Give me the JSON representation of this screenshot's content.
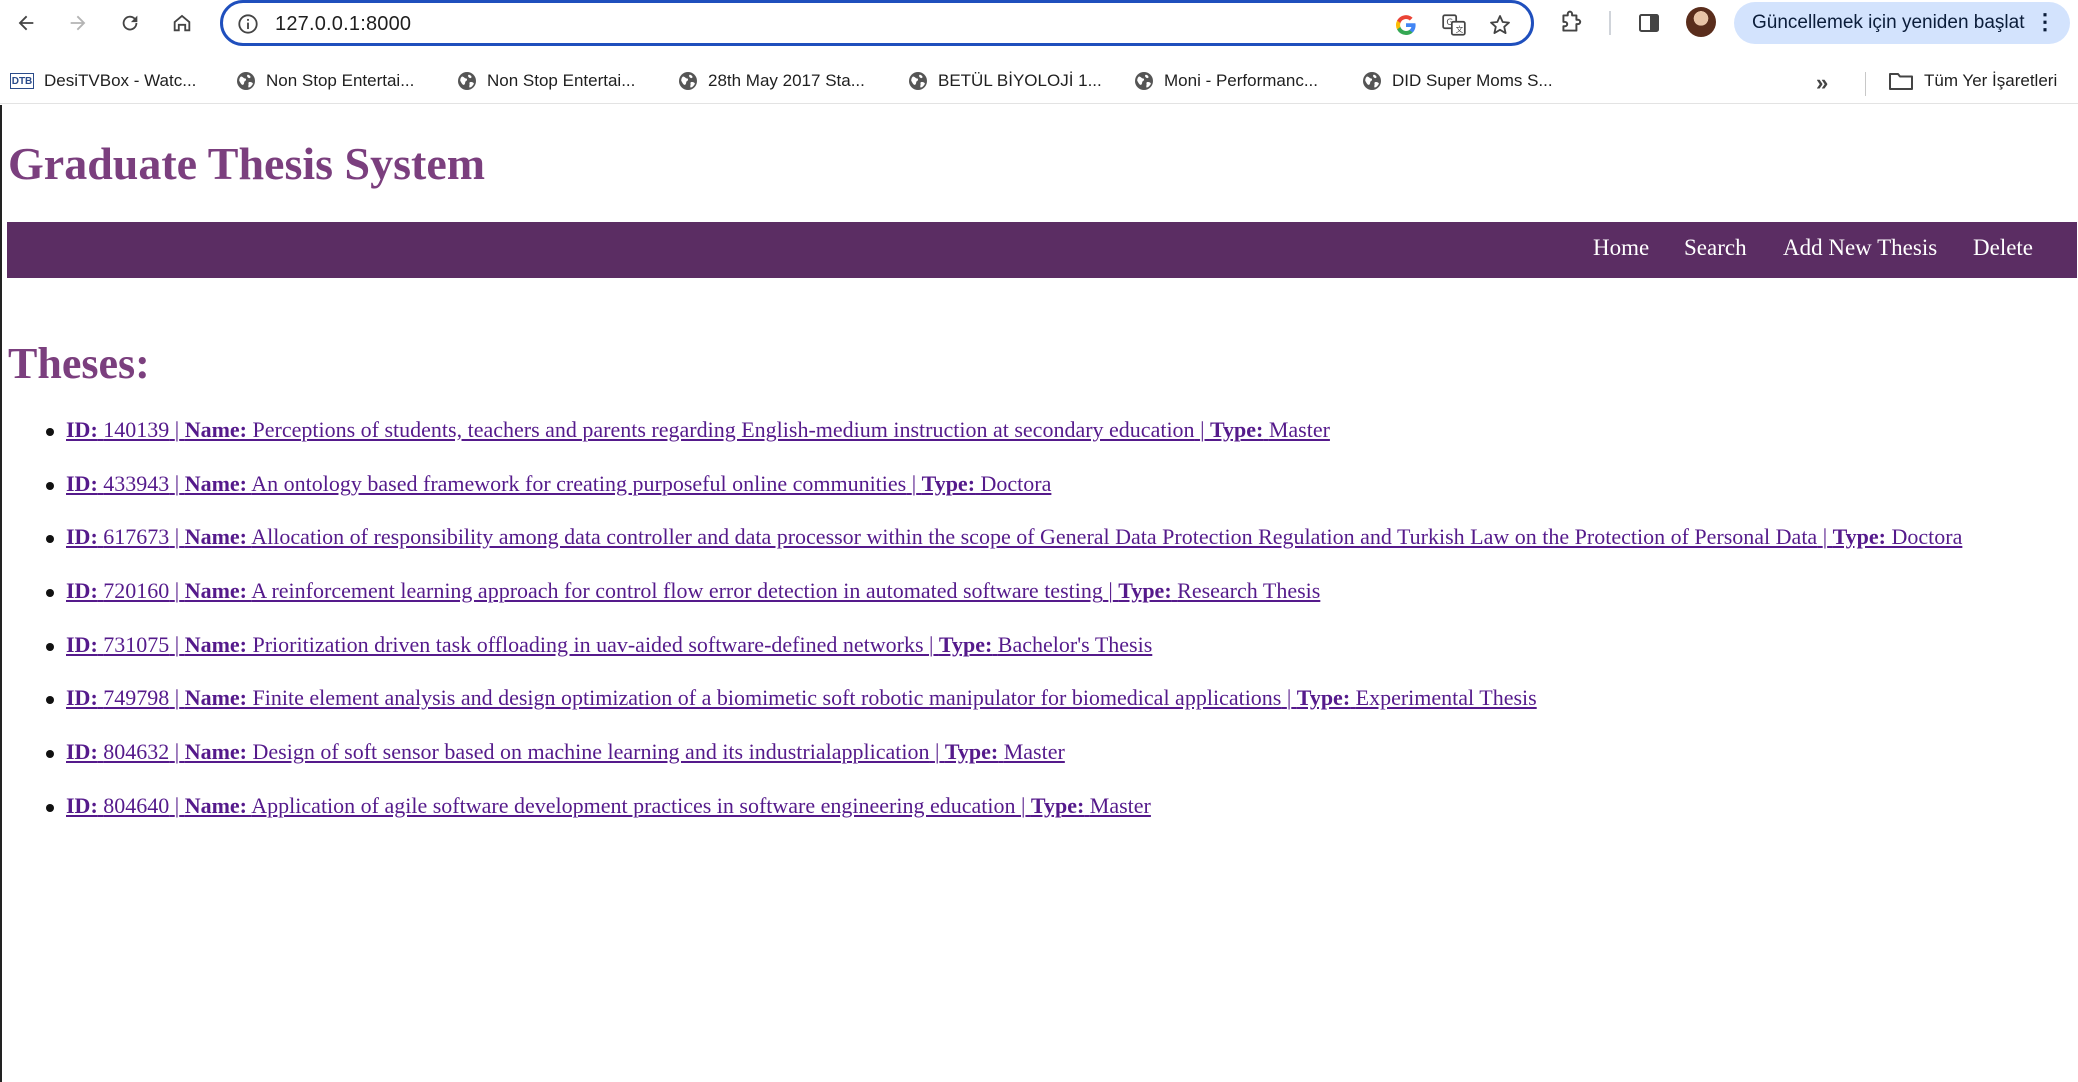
{
  "browser": {
    "url": "127.0.0.1:8000",
    "update_label": "Güncellemek için yeniden başlat",
    "icons": {
      "back": "arrow-left-icon",
      "forward": "arrow-right-icon",
      "reload": "reload-icon",
      "home": "home-icon",
      "site_info": "info-icon",
      "google": "google-icon",
      "translate": "translate-icon",
      "bookmark": "star-icon",
      "extensions": "puzzle-icon",
      "side_panel": "side-panel-icon",
      "menu": "kebab-menu-icon"
    }
  },
  "bookmarks": {
    "items": [
      {
        "label": "DesiTVBox - Watc...",
        "icon": "dtb-icon"
      },
      {
        "label": "Non Stop Entertai...",
        "icon": "globe-icon"
      },
      {
        "label": "Non Stop Entertai...",
        "icon": "globe-icon"
      },
      {
        "label": "28th May 2017 Sta...",
        "icon": "globe-icon"
      },
      {
        "label": "BETÜL BİYOLOJİ 1...",
        "icon": "globe-icon"
      },
      {
        "label": "Moni - Performanc...",
        "icon": "globe-icon"
      },
      {
        "label": "DID Super Moms S...",
        "icon": "globe-icon"
      }
    ],
    "more": "»",
    "all_bookmarks": "Tüm Yer İşaretleri"
  },
  "site": {
    "title": "Graduate Thesis System",
    "nav": [
      "Home",
      "Search",
      "Add New Thesis",
      "Delete"
    ],
    "section_title": "Theses:",
    "labels": {
      "id": "ID:",
      "name": "Name:",
      "type": "Type:",
      "sep": "|"
    },
    "theses": [
      {
        "id": "140139",
        "name": "Perceptions of students, teachers and parents regarding English-medium instruction at secondary education",
        "type": "Master"
      },
      {
        "id": "433943",
        "name": "An ontology based framework for creating purposeful online communities",
        "type": "Doctora"
      },
      {
        "id": "617673",
        "name": "Allocation of responsibility among data controller and data processor within the scope of General Data Protection Regulation and Turkish Law on the Protection of Personal Data",
        "type": "Doctora"
      },
      {
        "id": "720160",
        "name": "A reinforcement learning approach for control flow error detection in automated software testing",
        "type": "Research Thesis"
      },
      {
        "id": "731075",
        "name": "Prioritization driven task offloading in uav-aided software-defined networks",
        "type": "Bachelor's Thesis"
      },
      {
        "id": "749798",
        "name": "Finite element analysis and design optimization of a biomimetic soft robotic manipulator for biomedical applications",
        "type": "Experimental Thesis"
      },
      {
        "id": "804632",
        "name": "Design of soft sensor based on machine learning and its industrialapplication",
        "type": "Master"
      },
      {
        "id": "804640",
        "name": "Application of agile software development practices in software engineering education",
        "type": "Master"
      }
    ]
  },
  "colors": {
    "brand_purple": "#7b3f7e",
    "navbar_bg": "#5b2d63",
    "link_visited": "#551a8b",
    "omnibox_focus": "#1f4fbd",
    "update_pill_bg": "#d3e3fd"
  }
}
